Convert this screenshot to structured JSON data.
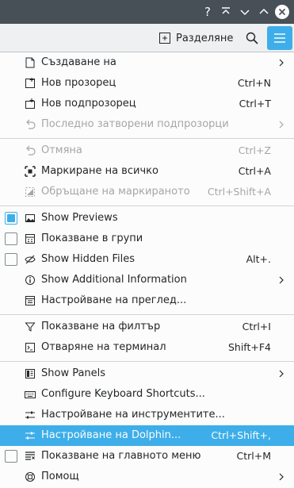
{
  "titlebar": {
    "help": "?",
    "buttons": [
      "help-icon",
      "keep-above-icon",
      "minimize-icon",
      "maximize-icon",
      "close-icon"
    ]
  },
  "toolbar": {
    "split_label": "Разделяне",
    "icons": [
      "split-view-icon",
      "search-icon",
      "hamburger-menu-icon"
    ]
  },
  "menu": {
    "accent": "#3daee9",
    "items": [
      {
        "label": "Създаване на",
        "shortcut": "",
        "icon": "new-document-icon",
        "submenu": true
      },
      {
        "label": "Нов прозорец",
        "shortcut": "Ctrl+N",
        "icon": "new-window-icon"
      },
      {
        "label": "Нов подпрозорец",
        "shortcut": "Ctrl+T",
        "icon": "new-tab-icon"
      },
      {
        "label": "Последно затворени подпрозорци",
        "shortcut": "",
        "icon": "undo-icon",
        "disabled": true,
        "submenu": true
      },
      {
        "label": "Отмяна",
        "shortcut": "Ctrl+Z",
        "icon": "undo-icon",
        "disabled": true
      },
      {
        "label": "Маркиране на всичко",
        "shortcut": "Ctrl+A",
        "icon": "select-all-icon"
      },
      {
        "label": "Обръщане на маркираното",
        "shortcut": "Ctrl+Shift+A",
        "icon": "invert-selection-icon",
        "disabled": true
      },
      {
        "label": "Show Previews",
        "shortcut": "",
        "icon": "image-icon",
        "checked": true
      },
      {
        "label": "Показване в групи",
        "shortcut": "",
        "icon": "groups-icon",
        "checked": false
      },
      {
        "label": "Show Hidden Files",
        "shortcut": "Alt+.",
        "icon": "hidden-files-icon",
        "checked": false
      },
      {
        "label": "Show Additional Information",
        "shortcut": "",
        "icon": "info-icon",
        "submenu": true
      },
      {
        "label": "Настройване на преглед...",
        "shortcut": "",
        "icon": "view-settings-icon"
      },
      {
        "label": "Показване на филтър",
        "shortcut": "Ctrl+I",
        "icon": "filter-icon"
      },
      {
        "label": "Отваряне на терминал",
        "shortcut": "Shift+F4",
        "icon": "terminal-icon"
      },
      {
        "label": "Show Panels",
        "shortcut": "",
        "icon": "panels-icon",
        "submenu": true
      },
      {
        "label": "Configure Keyboard Shortcuts...",
        "shortcut": "",
        "icon": "keyboard-icon"
      },
      {
        "label": "Настройване на инструментите...",
        "shortcut": "",
        "icon": "toolbar-settings-icon"
      },
      {
        "label": "Настройване на Dolphin...",
        "shortcut": "Ctrl+Shift+,",
        "icon": "configure-icon",
        "highlighted": true
      },
      {
        "label": "Показване на главното меню",
        "shortcut": "Ctrl+M",
        "icon": "show-menu-icon",
        "checked": false
      },
      {
        "label": "Помощ",
        "shortcut": "",
        "icon": "help-icon",
        "submenu": true
      }
    ]
  }
}
